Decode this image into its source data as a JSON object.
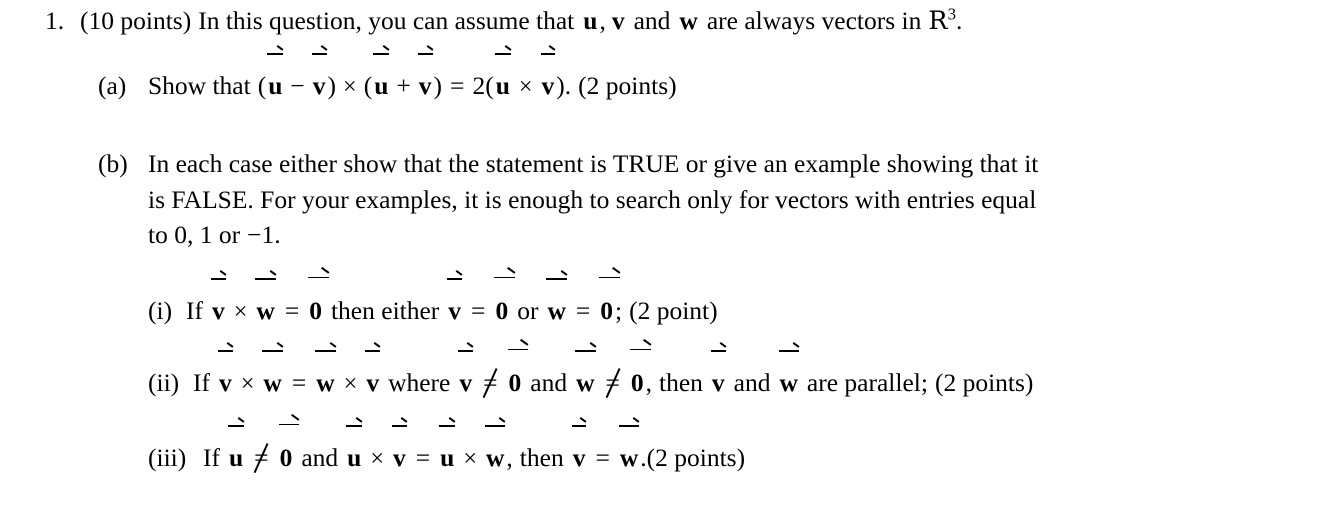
{
  "document": {
    "background_color": "#ffffff",
    "text_color": "#000000",
    "type": "math-exercise"
  },
  "question": {
    "number": "1.",
    "points_label": "(10 points)",
    "stem_before_vectors": "In this question, you can assume that",
    "vector_u": "u",
    "vector_v": "v",
    "vector_w": "w",
    "comma": ",",
    "and_word": "and",
    "stem_after_vectors": "are always vectors in",
    "space_symbol": "R",
    "space_exponent": "3",
    "period": "."
  },
  "parts": {
    "a": {
      "marker": "(a)",
      "verb": "Show that",
      "open_paren": "(",
      "minus": "−",
      "close_paren": ")",
      "times": "×",
      "plus": "+",
      "equals": "=",
      "coefficient": "2",
      "period": ".",
      "points": "(2 points)",
      "vector_u": "u",
      "vector_v": "v"
    },
    "b": {
      "marker": "(b)",
      "line1": "In each case either show that the statement is TRUE or give an example showing that it",
      "line2": "is FALSE. For your examples, it is enough to search only for vectors with entries equal",
      "line3_prefix": "to 0, 1 or",
      "line3_minus_one": "−1",
      "line3_period": ".",
      "subparts": {
        "i": {
          "marker": "(i)",
          "if_word": "If",
          "vector_v": "v",
          "vector_w": "w",
          "vector_zero": "0",
          "times": "×",
          "equals": "=",
          "then_either": "then either",
          "or_word": "or",
          "semicolon": ";",
          "points": "(2 point)"
        },
        "ii": {
          "marker": "(ii)",
          "if_word": "If",
          "vector_v": "v",
          "vector_w": "w",
          "vector_zero": "0",
          "times": "×",
          "equals": "=",
          "not_equals": "≠",
          "where_word": "where",
          "and_word": "and",
          "comma": ",",
          "then_word": "then",
          "and_word2": "and",
          "conclusion": "are parallel;",
          "points": "(2 points)"
        },
        "iii": {
          "marker": "(iii)",
          "if_word": "If",
          "vector_u": "u",
          "vector_v": "v",
          "vector_w": "w",
          "vector_zero": "0",
          "times": "×",
          "equals": "=",
          "not_equals": "≠",
          "and_word": "and",
          "comma": ",",
          "then_word": "then",
          "period": ".",
          "points": "(2 points)"
        }
      }
    }
  }
}
